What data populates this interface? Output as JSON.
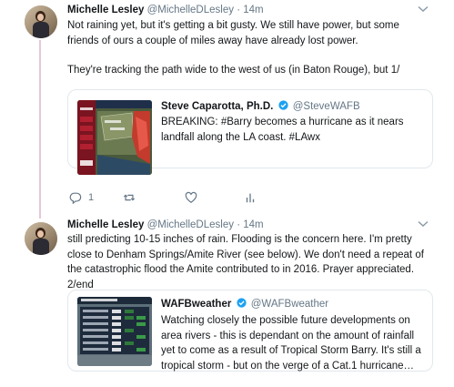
{
  "tweets": [
    {
      "author_name": "Michelle Lesley",
      "author_handle": "@MichelleDLesley",
      "dot": "·",
      "time": "14m",
      "paragraphs": [
        "Not raining yet, but it's getting a bit gusty. We still have power, but some friends of ours a couple of miles away have already lost power.",
        "They're tracking the path wide to the west of us (in Baton Rouge), but 1/"
      ],
      "quote": {
        "name": "Steve Caparotta, Ph.D.",
        "handle": "@SteveWAFB",
        "text": "BREAKING: #Barry becomes a hurricane as it nears landfall along the LA coast. #LAwx"
      },
      "actions": {
        "reply_count": "1"
      }
    },
    {
      "author_name": "Michelle Lesley",
      "author_handle": "@MichelleDLesley",
      "dot": "·",
      "time": "14m",
      "text": "still predicting 10-15 inches of rain. Flooding is the concern here. I'm pretty close to Denham Springs/Amite River (see below). We don't need a repeat of the catastrophic flood the Amite contributed to in 2016. Prayer appreciated. 2/end",
      "quote": {
        "name": "WAFBweather",
        "handle": "@WAFBweather",
        "text": "Watching closely the possible future developments on area rivers - this is dependant on the amount of rainfall yet to come as a result of Tropical Storm Barry.  It's still a tropical storm - but on the verge of a Cat.1 hurricane…"
      }
    }
  ],
  "colors": {
    "thread_line": "#e5cad6",
    "verified": "#1da1f2",
    "muted": "#657786"
  },
  "icons": [
    "chevron-down-icon",
    "verified-badge-icon",
    "reply-icon",
    "retweet-icon",
    "like-icon",
    "analytics-icon"
  ]
}
